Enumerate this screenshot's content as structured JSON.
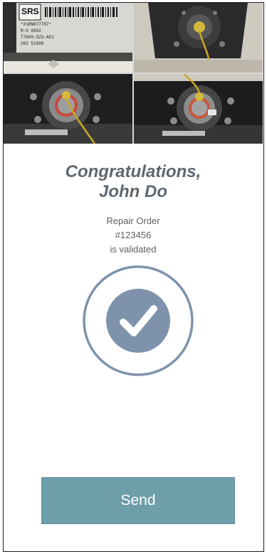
{
  "photos": {
    "srs_label": {
      "title": "SRS",
      "lines": [
        "*X1RN077787*",
        "M-0 0902",
        "77800-SZ3-A51",
        "302     51008"
      ]
    }
  },
  "confirmation": {
    "greeting_line1": "Congratulations,",
    "greeting_line2": "John Do",
    "status_line1": "Repair Order",
    "status_line2": "#123456",
    "status_line3": "is validated"
  },
  "actions": {
    "send_label": "Send"
  },
  "colors": {
    "accent": "#6e9eaa",
    "check_circle": "#7e93ab",
    "heading": "#5e6872"
  }
}
